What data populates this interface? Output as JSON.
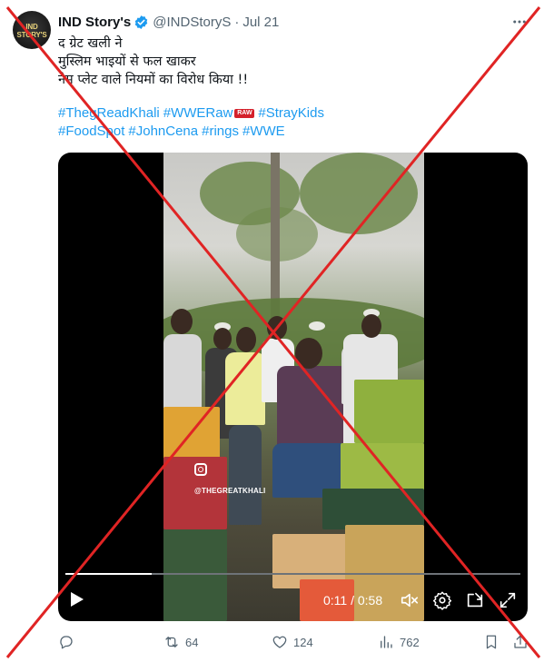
{
  "author": {
    "avatar_text": "IND STORY'S",
    "name": "IND Story's",
    "handle": "@INDStoryS",
    "separator": "·",
    "date": "Jul 21"
  },
  "tweet_text": {
    "line1": "द ग्रेट खली ने",
    "line2": "मुस्लिम भाइयों से फल खाकर",
    "line3": "नेम प्लेट वाले नियमों का विरोध किया !!"
  },
  "hashtags": {
    "row1": [
      "#ThegReadKhali",
      "#WWERaw",
      "#StrayKids"
    ],
    "raw_emoji": "RAW",
    "row2": [
      "#FoodSpot",
      "#JohnCena",
      "#rings",
      "#WWE"
    ]
  },
  "video": {
    "watermark": "@THEGREATKHALI",
    "time": "0:11 / 0:58",
    "progress_fraction": 0.19
  },
  "actions": {
    "reply_count": "",
    "retweet_count": "64",
    "like_count": "124",
    "views_count": "762"
  },
  "colors": {
    "link": "#1d9bf0",
    "verified": "#1d9bf0",
    "cross": "#e02424"
  }
}
